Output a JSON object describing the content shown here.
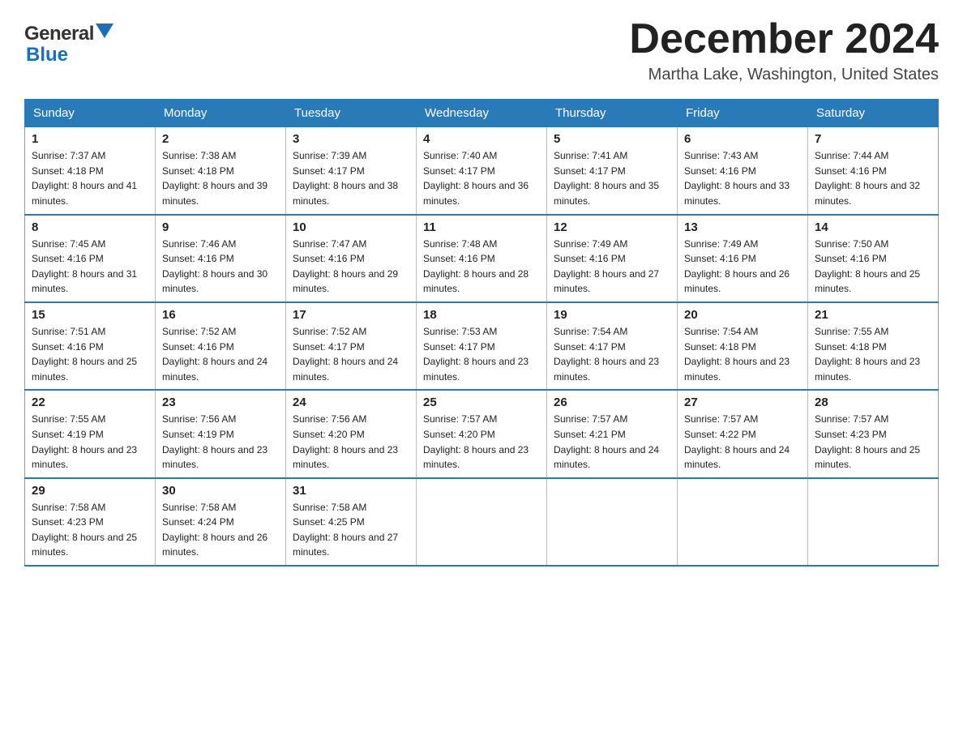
{
  "header": {
    "logo_general": "General",
    "logo_blue": "Blue",
    "month_title": "December 2024",
    "location": "Martha Lake, Washington, United States"
  },
  "days_of_week": [
    "Sunday",
    "Monday",
    "Tuesday",
    "Wednesday",
    "Thursday",
    "Friday",
    "Saturday"
  ],
  "weeks": [
    [
      {
        "day": "1",
        "sunrise": "7:37 AM",
        "sunset": "4:18 PM",
        "daylight": "8 hours and 41 minutes."
      },
      {
        "day": "2",
        "sunrise": "7:38 AM",
        "sunset": "4:18 PM",
        "daylight": "8 hours and 39 minutes."
      },
      {
        "day": "3",
        "sunrise": "7:39 AM",
        "sunset": "4:17 PM",
        "daylight": "8 hours and 38 minutes."
      },
      {
        "day": "4",
        "sunrise": "7:40 AM",
        "sunset": "4:17 PM",
        "daylight": "8 hours and 36 minutes."
      },
      {
        "day": "5",
        "sunrise": "7:41 AM",
        "sunset": "4:17 PM",
        "daylight": "8 hours and 35 minutes."
      },
      {
        "day": "6",
        "sunrise": "7:43 AM",
        "sunset": "4:16 PM",
        "daylight": "8 hours and 33 minutes."
      },
      {
        "day": "7",
        "sunrise": "7:44 AM",
        "sunset": "4:16 PM",
        "daylight": "8 hours and 32 minutes."
      }
    ],
    [
      {
        "day": "8",
        "sunrise": "7:45 AM",
        "sunset": "4:16 PM",
        "daylight": "8 hours and 31 minutes."
      },
      {
        "day": "9",
        "sunrise": "7:46 AM",
        "sunset": "4:16 PM",
        "daylight": "8 hours and 30 minutes."
      },
      {
        "day": "10",
        "sunrise": "7:47 AM",
        "sunset": "4:16 PM",
        "daylight": "8 hours and 29 minutes."
      },
      {
        "day": "11",
        "sunrise": "7:48 AM",
        "sunset": "4:16 PM",
        "daylight": "8 hours and 28 minutes."
      },
      {
        "day": "12",
        "sunrise": "7:49 AM",
        "sunset": "4:16 PM",
        "daylight": "8 hours and 27 minutes."
      },
      {
        "day": "13",
        "sunrise": "7:49 AM",
        "sunset": "4:16 PM",
        "daylight": "8 hours and 26 minutes."
      },
      {
        "day": "14",
        "sunrise": "7:50 AM",
        "sunset": "4:16 PM",
        "daylight": "8 hours and 25 minutes."
      }
    ],
    [
      {
        "day": "15",
        "sunrise": "7:51 AM",
        "sunset": "4:16 PM",
        "daylight": "8 hours and 25 minutes."
      },
      {
        "day": "16",
        "sunrise": "7:52 AM",
        "sunset": "4:16 PM",
        "daylight": "8 hours and 24 minutes."
      },
      {
        "day": "17",
        "sunrise": "7:52 AM",
        "sunset": "4:17 PM",
        "daylight": "8 hours and 24 minutes."
      },
      {
        "day": "18",
        "sunrise": "7:53 AM",
        "sunset": "4:17 PM",
        "daylight": "8 hours and 23 minutes."
      },
      {
        "day": "19",
        "sunrise": "7:54 AM",
        "sunset": "4:17 PM",
        "daylight": "8 hours and 23 minutes."
      },
      {
        "day": "20",
        "sunrise": "7:54 AM",
        "sunset": "4:18 PM",
        "daylight": "8 hours and 23 minutes."
      },
      {
        "day": "21",
        "sunrise": "7:55 AM",
        "sunset": "4:18 PM",
        "daylight": "8 hours and 23 minutes."
      }
    ],
    [
      {
        "day": "22",
        "sunrise": "7:55 AM",
        "sunset": "4:19 PM",
        "daylight": "8 hours and 23 minutes."
      },
      {
        "day": "23",
        "sunrise": "7:56 AM",
        "sunset": "4:19 PM",
        "daylight": "8 hours and 23 minutes."
      },
      {
        "day": "24",
        "sunrise": "7:56 AM",
        "sunset": "4:20 PM",
        "daylight": "8 hours and 23 minutes."
      },
      {
        "day": "25",
        "sunrise": "7:57 AM",
        "sunset": "4:20 PM",
        "daylight": "8 hours and 23 minutes."
      },
      {
        "day": "26",
        "sunrise": "7:57 AM",
        "sunset": "4:21 PM",
        "daylight": "8 hours and 24 minutes."
      },
      {
        "day": "27",
        "sunrise": "7:57 AM",
        "sunset": "4:22 PM",
        "daylight": "8 hours and 24 minutes."
      },
      {
        "day": "28",
        "sunrise": "7:57 AM",
        "sunset": "4:23 PM",
        "daylight": "8 hours and 25 minutes."
      }
    ],
    [
      {
        "day": "29",
        "sunrise": "7:58 AM",
        "sunset": "4:23 PM",
        "daylight": "8 hours and 25 minutes."
      },
      {
        "day": "30",
        "sunrise": "7:58 AM",
        "sunset": "4:24 PM",
        "daylight": "8 hours and 26 minutes."
      },
      {
        "day": "31",
        "sunrise": "7:58 AM",
        "sunset": "4:25 PM",
        "daylight": "8 hours and 27 minutes."
      },
      null,
      null,
      null,
      null
    ]
  ],
  "labels": {
    "sunrise_prefix": "Sunrise: ",
    "sunset_prefix": "Sunset: ",
    "daylight_prefix": "Daylight: "
  }
}
